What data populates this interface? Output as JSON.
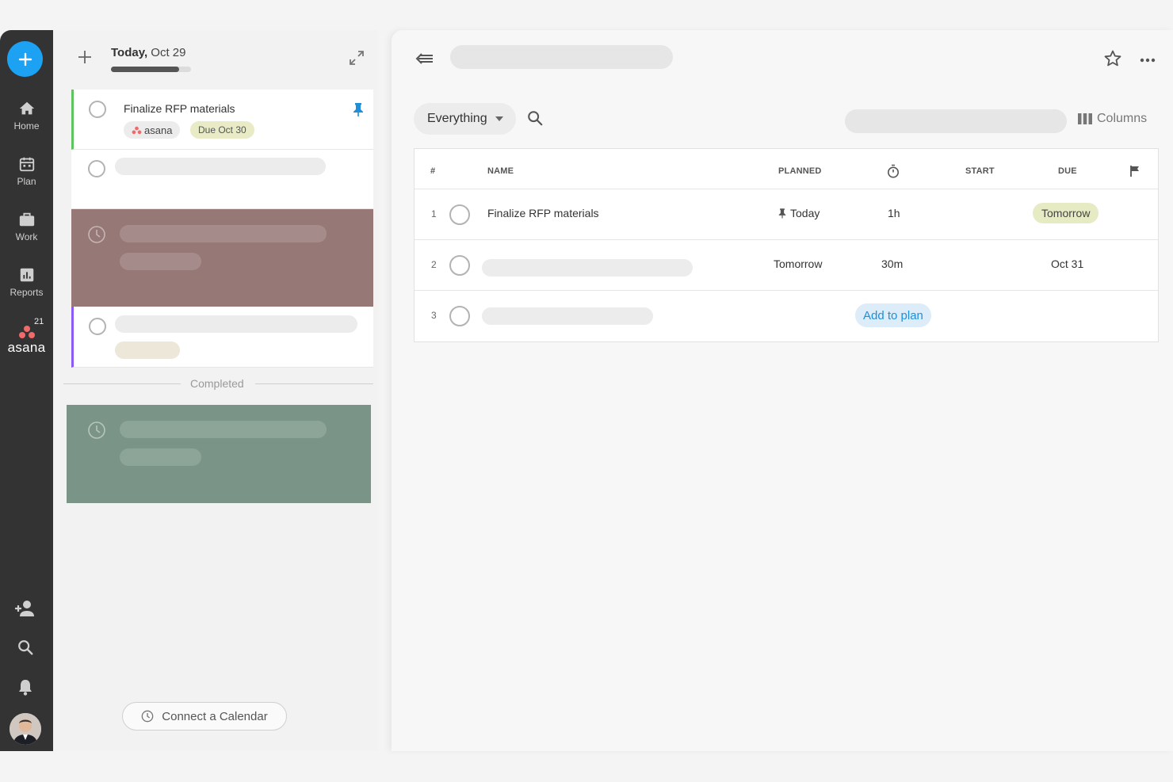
{
  "rail": {
    "items": [
      {
        "label": "Home",
        "icon": "home-icon"
      },
      {
        "label": "Plan",
        "icon": "calendar-icon"
      },
      {
        "label": "Work",
        "icon": "briefcase-icon"
      },
      {
        "label": "Reports",
        "icon": "bar-chart-icon"
      }
    ],
    "asana_logo": "asana",
    "asana_badge": "21"
  },
  "day": {
    "title_bold": "Today,",
    "title_date": "Oct 29",
    "progress": 0.85,
    "task": {
      "title": "Finalize RFP materials",
      "tag": "asana",
      "due": "Due Oct 30"
    },
    "completed_label": "Completed",
    "connect_label": "Connect a Calendar"
  },
  "main": {
    "filter_label": "Everything",
    "columns_label": "Columns",
    "table": {
      "headers": {
        "num": "#",
        "name": "NAME",
        "planned": "PLANNED",
        "start": "START",
        "due": "DUE"
      },
      "rows": [
        {
          "num": "1",
          "name": "Finalize RFP materials",
          "planned": "Today",
          "estimate": "1h",
          "due": "Tomorrow"
        },
        {
          "num": "2",
          "planned": "Tomorrow",
          "estimate": "30m",
          "due": "Oct 31"
        },
        {
          "num": "3",
          "action": "Add to plan"
        }
      ]
    }
  },
  "colors": {
    "rail": "#333333",
    "accent": "#1da1f2",
    "green_bar": "#5fc45f",
    "purple_bar": "#8a5cf5",
    "event_red": "#967876",
    "event_green": "#7a9587"
  }
}
